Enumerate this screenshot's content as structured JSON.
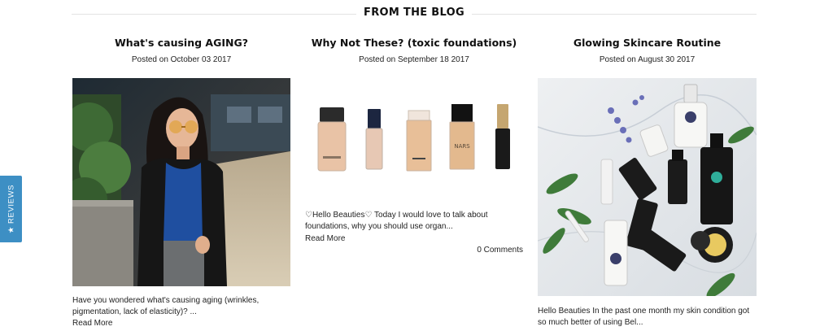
{
  "section": {
    "title": "FROM THE BLOG"
  },
  "posts": [
    {
      "title": "What's causing AGING?",
      "date": "Posted on October 03 2017",
      "excerpt": " Have you wondered what's causing aging (wrinkles, pigmentation, lack of elasticity)? ...",
      "read_more": "Read More"
    },
    {
      "title": "Why Not These? (toxic foundations)",
      "date": "Posted on September 18 2017",
      "excerpt": "♡Hello Beauties♡ Today I would love to talk about foundations, why you should use organ...",
      "read_more": "Read More",
      "comments": "0 Comments"
    },
    {
      "title": "Glowing Skincare Routine",
      "date": "Posted on August 30 2017",
      "excerpt": "Hello Beauties  In the past one month my skin condition got so much better of using Bel..."
    }
  ],
  "reviews_tab": {
    "label": "REVIEWS",
    "icon": "star-icon"
  },
  "colors": {
    "reviews_tab": "#3d8fc4",
    "divider": "#e3e3e3",
    "text": "#222222"
  }
}
